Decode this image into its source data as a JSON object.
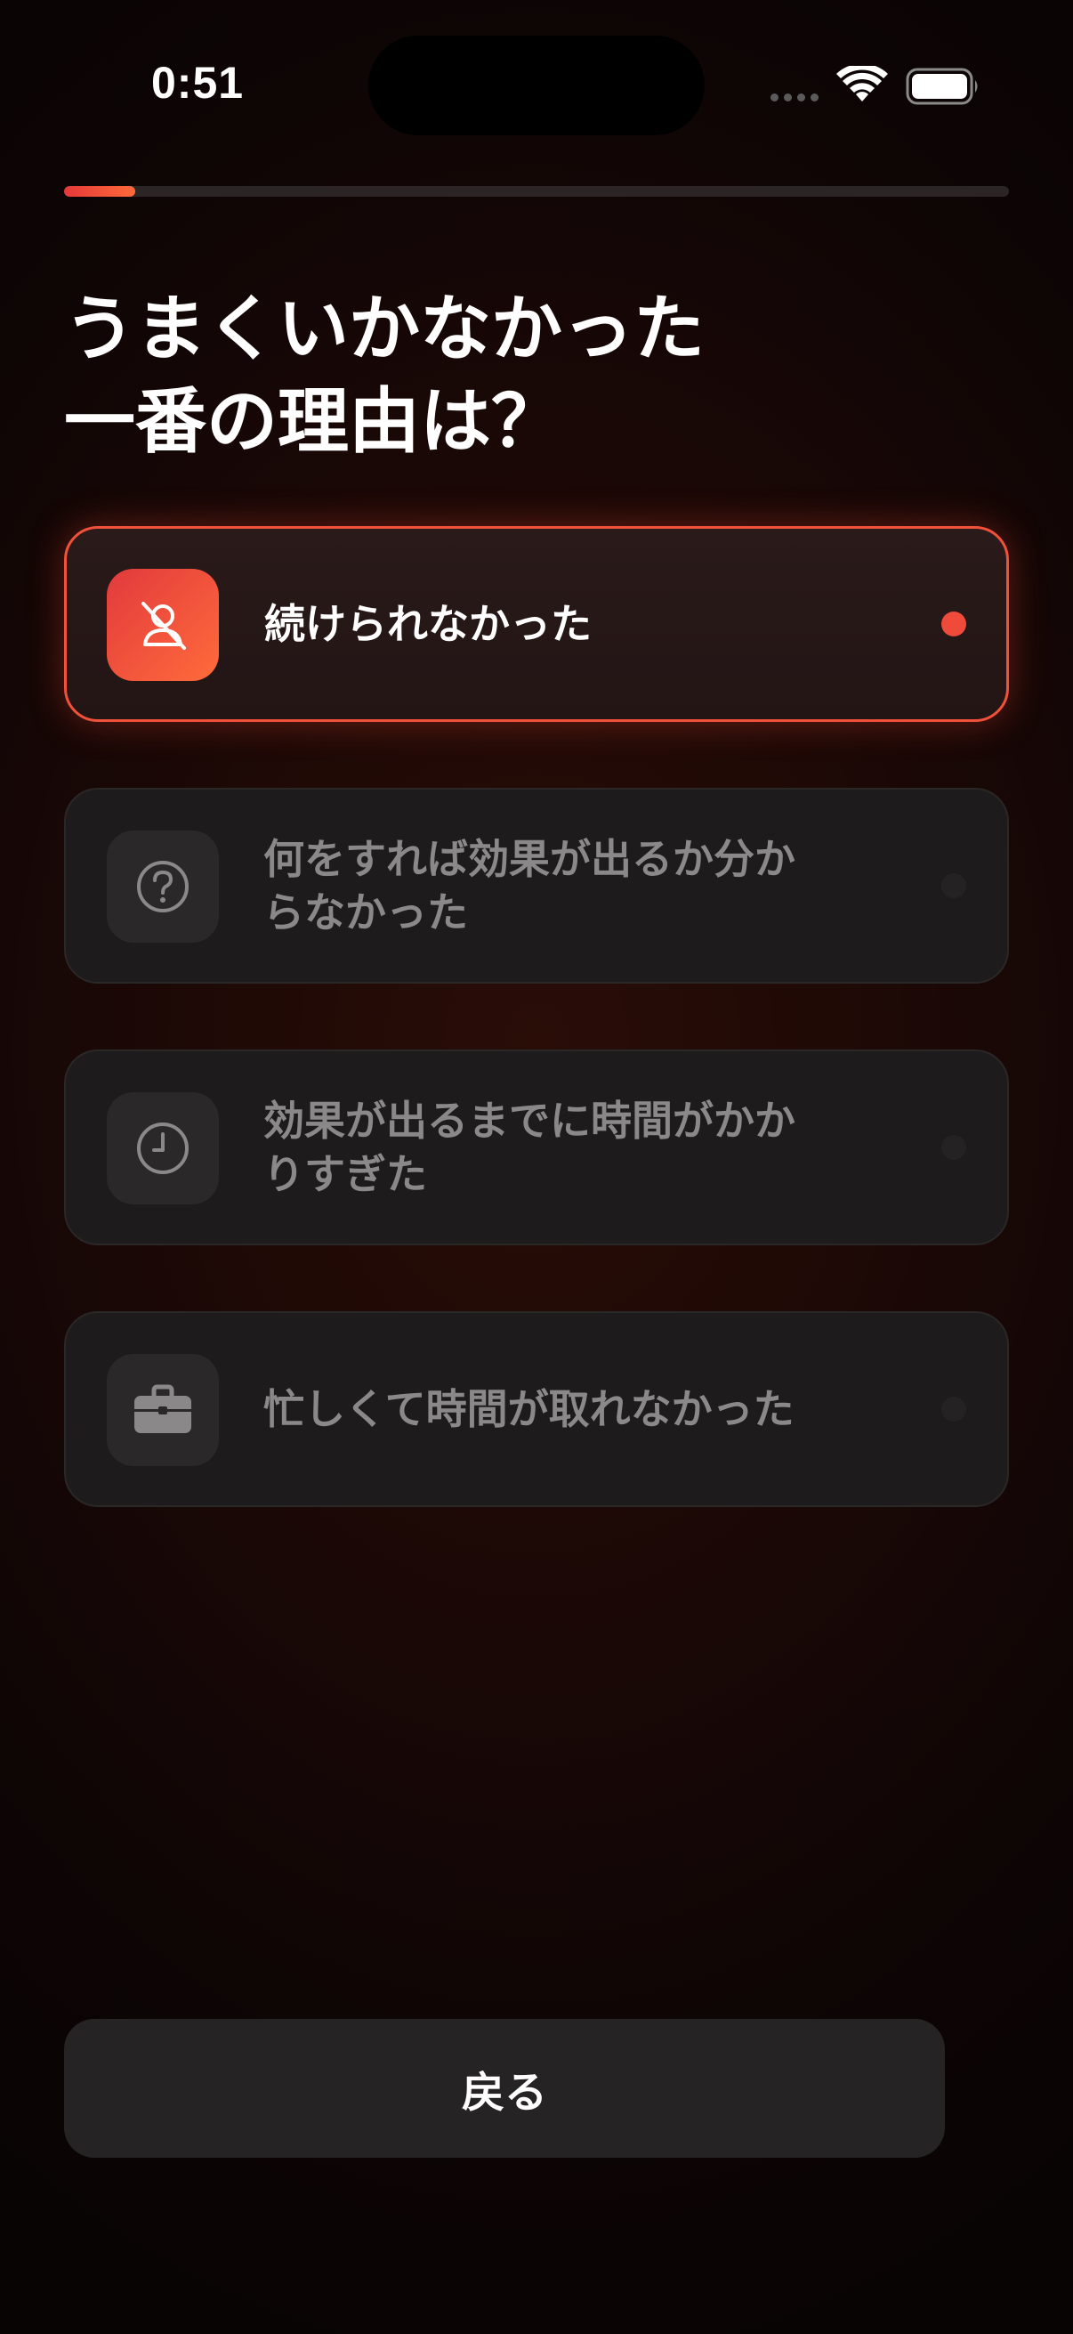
{
  "status_bar": {
    "time": "0:51"
  },
  "progress": {
    "fraction": 0.075
  },
  "title": {
    "line1": "うまくいかなかった",
    "line2": "一番の理由は？"
  },
  "options": [
    {
      "label": "続けられなかった",
      "icon": "no-person-icon",
      "selected": true
    },
    {
      "label_line1": "何をすれば効果が出るか分か",
      "label_line2": "らなかった",
      "icon": "question-icon",
      "selected": false
    },
    {
      "label_line1": "効果が出るまでに時間がかか",
      "label_line2": "りすぎた",
      "icon": "clock-icon",
      "selected": false
    },
    {
      "label": "忙しくて時間が取れなかった",
      "icon": "briefcase-icon",
      "selected": false
    }
  ],
  "footer": {
    "back_label": "戻る"
  },
  "colors": {
    "accent_start": "#e4383a",
    "accent_end": "#ff6a3a"
  }
}
